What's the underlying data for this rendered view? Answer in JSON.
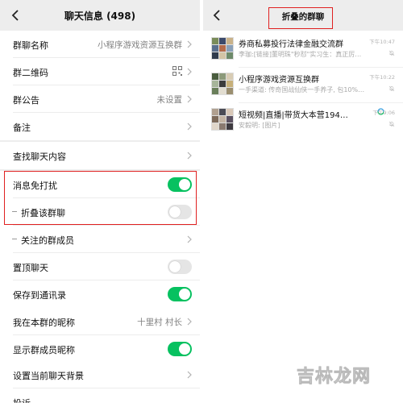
{
  "left": {
    "title": "聊天信息 (498)",
    "rows": [
      {
        "label": "群聊名称",
        "value": "小程序游戏资源互换群"
      },
      {
        "label": "群二维码"
      },
      {
        "label": "群公告",
        "value": "未设置"
      },
      {
        "label": "备注"
      },
      {
        "label": "查找聊天内容"
      },
      {
        "label": "消息免打扰",
        "toggle": "on"
      },
      {
        "label": "折叠该群聊",
        "toggle": "off"
      },
      {
        "label": "关注的群成员"
      },
      {
        "label": "置顶聊天",
        "toggle": "off"
      },
      {
        "label": "保存到通讯录",
        "toggle": "on"
      },
      {
        "label": "我在本群的昵称",
        "value": "十里村 村长"
      },
      {
        "label": "显示群成员昵称",
        "toggle": "on"
      },
      {
        "label": "设置当前聊天背景"
      },
      {
        "label": "投诉"
      }
    ]
  },
  "right": {
    "title": "折叠的群聊",
    "chats": [
      {
        "name": "券商私募投行法律金融交流群",
        "preview": "李珈:[链接]董明珠\"秒怼\"实习生：真正厉…",
        "time": "下午10:47"
      },
      {
        "name": "小程序游戏资源互换群",
        "preview": "一手渠道: 传奇国战仙侠一手养子, 包10%…",
        "time": "下午10:22"
      },
      {
        "name": "短视频|直播|带货大本营194…",
        "preview": "安毅明: [图片]",
        "time": "下午9:06"
      }
    ]
  },
  "watermark": "吉林龙网",
  "colors": {
    "toggle_on": "#07c160",
    "highlight": "#e02020",
    "background": "#ededed"
  }
}
